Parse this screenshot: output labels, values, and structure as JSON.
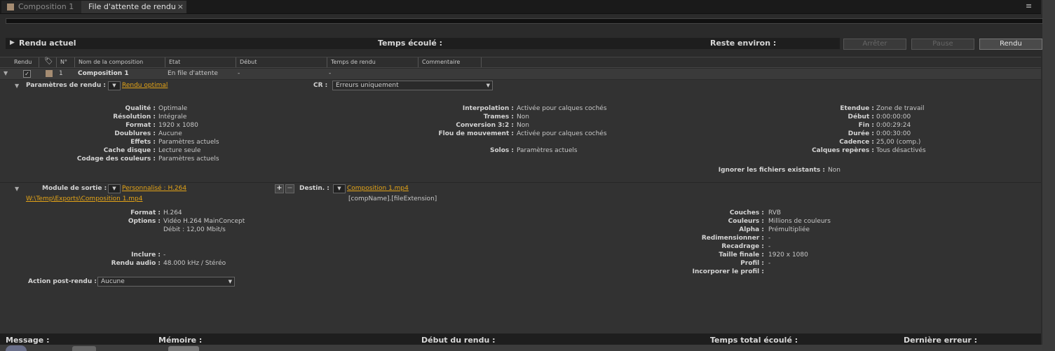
{
  "tabs": [
    {
      "label": "Composition 1"
    },
    {
      "label": "File d'attente de rendu"
    }
  ],
  "render_header": {
    "title": "Rendu actuel",
    "elapsed_label": "Temps écoulé :",
    "remaining_label": "Reste environ :",
    "stop_label": "Arrêter",
    "pause_label": "Pause",
    "render_label": "Rendu"
  },
  "columns": {
    "render": "Rendu",
    "num": "N°",
    "comp_name": "Nom de la composition",
    "status": "Etat",
    "start": "Début",
    "render_time": "Temps de rendu",
    "comment": "Commentaire"
  },
  "queue_item": {
    "num": "1",
    "comp_name": "Composition 1",
    "status": "En file d'attente",
    "start": "-",
    "render_time": "-",
    "checked": true
  },
  "render_settings": {
    "label": "Paramètres de rendu :",
    "preset": "Rendu optimal",
    "log_label": "CR :",
    "log_value": "Erreurs uniquement",
    "left": [
      {
        "label": "Qualité :",
        "value": "Optimale"
      },
      {
        "label": "Résolution :",
        "value": "Intégrale"
      },
      {
        "label": "Format :",
        "value": "1920 x 1080"
      },
      {
        "label": "Doublures :",
        "value": "Aucune"
      },
      {
        "label": "Effets :",
        "value": "Paramètres actuels"
      },
      {
        "label": "Cache disque :",
        "value": "Lecture seule"
      },
      {
        "label": "Codage des couleurs :",
        "value": "Paramètres actuels"
      }
    ],
    "middle": [
      {
        "label": "Interpolation :",
        "value": "Activée pour calques cochés"
      },
      {
        "label": "Trames :",
        "value": "Non"
      },
      {
        "label": "Conversion 3:2 :",
        "value": "Non"
      },
      {
        "label": "Flou de mouvement :",
        "value": "Activée pour calques cochés"
      },
      {
        "label": "",
        "value": ""
      },
      {
        "label": "Solos :",
        "value": "Paramètres actuels"
      }
    ],
    "right": [
      {
        "label": "Etendue :",
        "value": "Zone de travail"
      },
      {
        "label": "Début :",
        "value": "0:00:00:00"
      },
      {
        "label": "Fin :",
        "value": "0:00:29:24"
      },
      {
        "label": "Durée :",
        "value": "0:00:30:00"
      },
      {
        "label": "Cadence :",
        "value": "25,00 (comp.)"
      },
      {
        "label": "Calques repères :",
        "value": "Tous désactivés"
      }
    ],
    "skip_existing_label": "Ignorer les fichiers existants :",
    "skip_existing_value": "Non"
  },
  "output_module": {
    "label": "Module de sortie :",
    "preset": "Personnalisé : H.264",
    "path": "W:\\Temp\\Exports\\Composition 1.mp4",
    "dest_label": "Destin. :",
    "dest_file": "Composition 1.mp4",
    "dest_template": "[compName].[fileExtension]",
    "format_label": "Format :",
    "format_value": "H.264",
    "options_label": "Options :",
    "options_value1": "Vidéo H.264 MainConcept",
    "options_value2": "Débit : 12,00 Mbit/s",
    "include_label": "Inclure :",
    "include_value": "-",
    "audio_label": "Rendu audio :",
    "audio_value": "48.000 kHz / Stéréo",
    "right": [
      {
        "label": "Couches :",
        "value": "RVB"
      },
      {
        "label": "Couleurs :",
        "value": "Millions de couleurs"
      },
      {
        "label": "Alpha :",
        "value": "Prémultipliée"
      },
      {
        "label": "Redimensionner :",
        "value": "-"
      },
      {
        "label": "Recadrage :",
        "value": "-"
      },
      {
        "label": "Taille finale :",
        "value": "1920 x 1080"
      },
      {
        "label": "Profil :",
        "value": "-"
      },
      {
        "label": "Incorporer le profil :",
        "value": ""
      }
    ],
    "post_render_label": "Action post-rendu :",
    "post_render_value": "Aucune"
  },
  "status_bar": {
    "message": "Message :",
    "memory": "Mémoire :",
    "render_start": "Début du rendu :",
    "total_elapsed": "Temps total écoulé :",
    "last_error": "Dernière erreur :"
  },
  "colors": {
    "accent_link": "#e4a417",
    "label_chip": "#a58c72"
  }
}
